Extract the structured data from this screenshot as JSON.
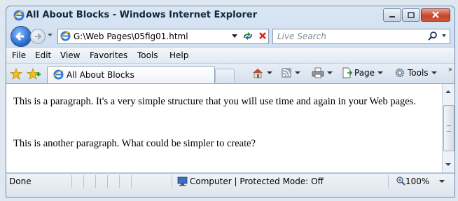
{
  "window": {
    "title": "All About Blocks - Windows Internet Explorer"
  },
  "nav": {
    "address": "G:\\Web Pages\\05fig01.html",
    "search_placeholder": "Live Search"
  },
  "menu": [
    "File",
    "Edit",
    "View",
    "Favorites",
    "Tools",
    "Help"
  ],
  "tab": {
    "title": "All About Blocks"
  },
  "commands": {
    "page_label": "Page",
    "tools_label": "Tools"
  },
  "content": {
    "paragraphs": [
      "This is a paragraph. It's a very simple structure that you will use time and again in your Web pages.",
      "This is another paragraph. What could be simpler to create?"
    ]
  },
  "status": {
    "text": "Done",
    "zone": "Computer | Protected Mode: Off",
    "zoom": "100%"
  }
}
